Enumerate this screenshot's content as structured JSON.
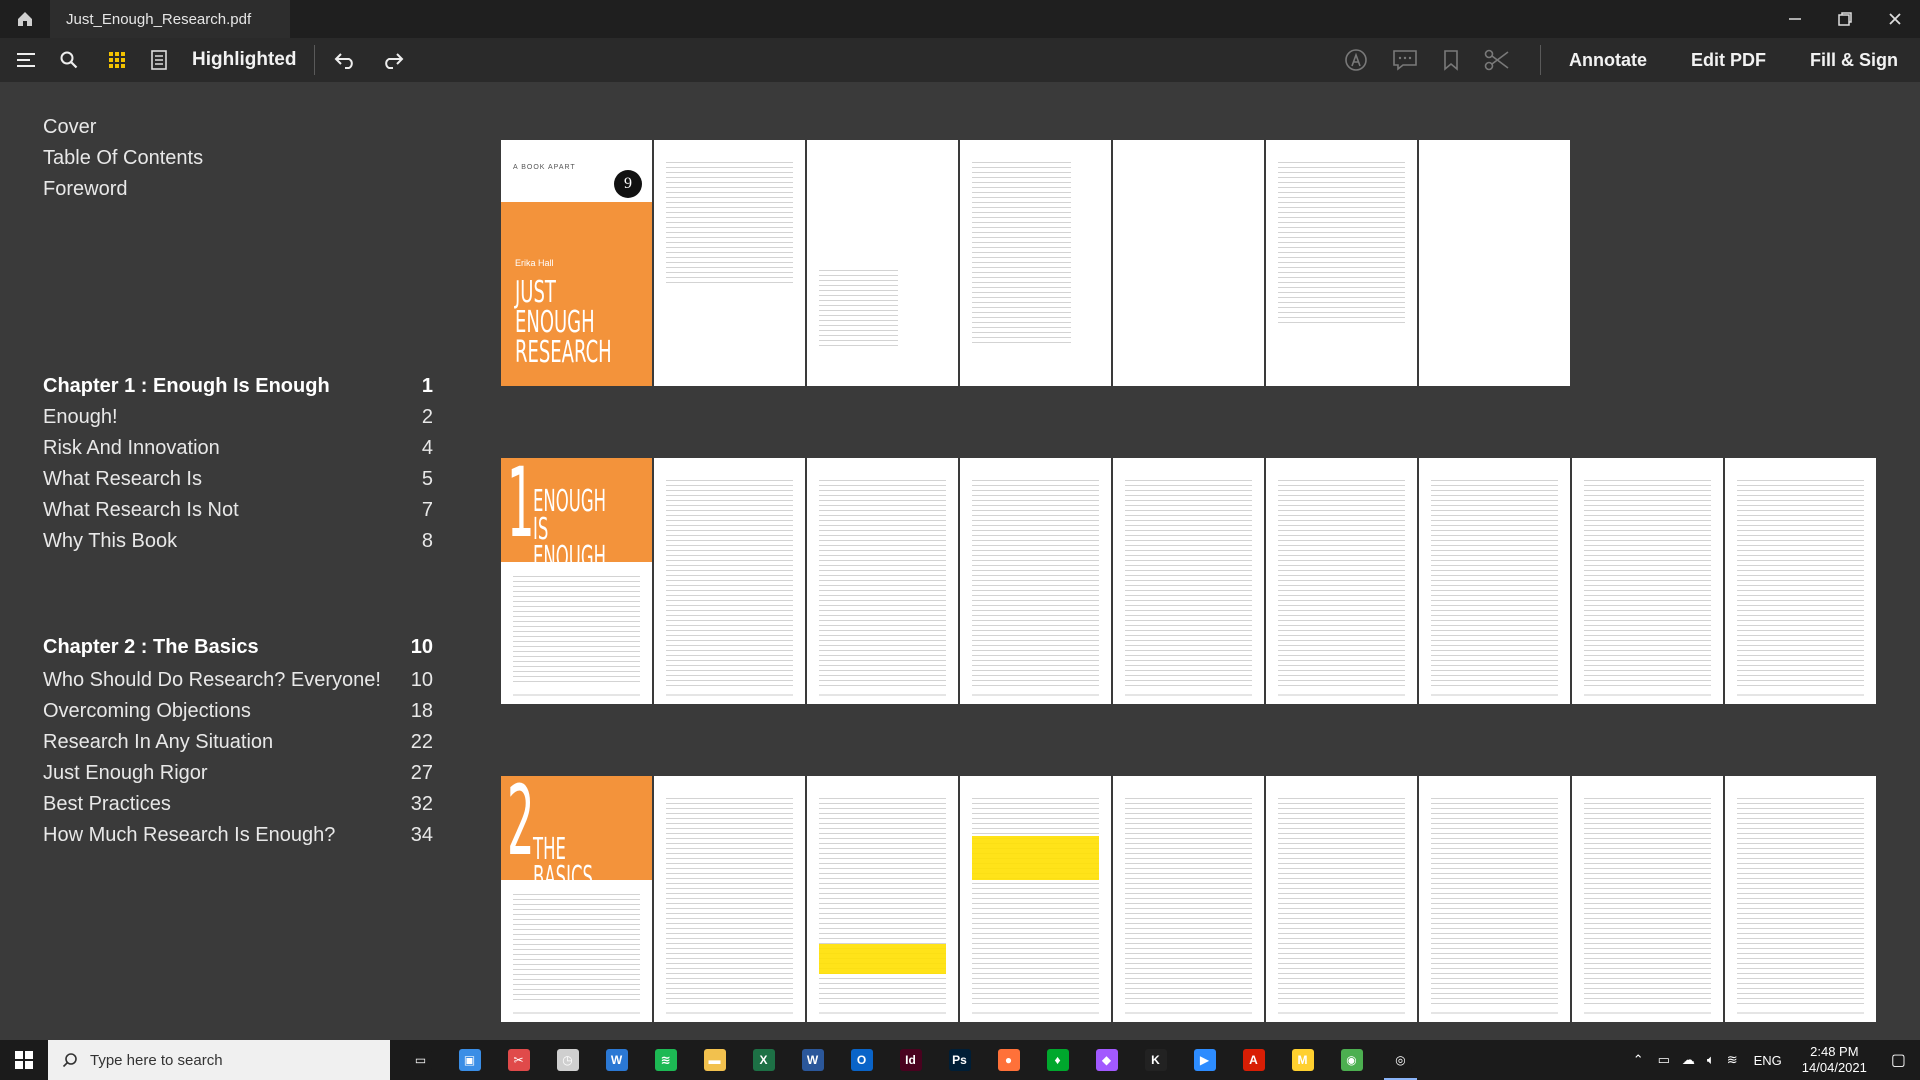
{
  "window": {
    "tab_title": "Just_Enough_Research.pdf"
  },
  "toolbar": {
    "view_label": "Highlighted",
    "annotate_label": "Annotate",
    "edit_label": "Edit PDF",
    "fill_sign_label": "Fill & Sign"
  },
  "toc": [
    {
      "label": "Cover",
      "page": "",
      "bold": false
    },
    {
      "label": "Table Of Contents",
      "page": "",
      "bold": false
    },
    {
      "label": "Foreword",
      "page": "",
      "bold": false
    },
    {
      "label": "Chapter 1 : Enough Is Enough",
      "page": "1",
      "bold": true
    },
    {
      "label": "Enough!",
      "page": "2",
      "bold": false
    },
    {
      "label": "Risk And Innovation",
      "page": "4",
      "bold": false
    },
    {
      "label": "What Research Is",
      "page": "5",
      "bold": false
    },
    {
      "label": "What Research Is Not",
      "page": "7",
      "bold": false
    },
    {
      "label": "Why This Book",
      "page": "8",
      "bold": false
    },
    {
      "label": "Chapter 2 : The Basics",
      "page": "10",
      "bold": true
    },
    {
      "label": "Who Should Do Research? Everyone!",
      "page": "10",
      "bold": false
    },
    {
      "label": "Overcoming Objections",
      "page": "18",
      "bold": false
    },
    {
      "label": "Research In Any Situation",
      "page": "22",
      "bold": false
    },
    {
      "label": "Just Enough Rigor",
      "page": "27",
      "bold": false
    },
    {
      "label": "Best Practices",
      "page": "32",
      "bold": false
    },
    {
      "label": "How Much Research Is Enough?",
      "page": "34",
      "bold": false
    }
  ],
  "cover": {
    "publisher": "A BOOK APART",
    "number": "9",
    "author": "Erika Hall",
    "title_line1": "JUST ENOUGH",
    "title_line2": "RESEARCH"
  },
  "chapters": [
    {
      "num": "1",
      "title_line1": "ENOUGH",
      "title_line2": "IS ENOUGH"
    },
    {
      "num": "2",
      "title_line1": "THE BASICS",
      "title_line2": ""
    }
  ],
  "taskbar": {
    "search_placeholder": "Type here to search",
    "time": "2:48 PM",
    "date": "14/04/2021",
    "lang": "ENG",
    "apps": [
      {
        "name": "task-view",
        "color": "#1b1b1b",
        "glyph": "▭"
      },
      {
        "name": "remote-desktop",
        "color": "#3a8ee6",
        "glyph": "▣"
      },
      {
        "name": "snip-tool",
        "color": "#e04a4a",
        "glyph": "✂"
      },
      {
        "name": "clock-app",
        "color": "#cfcfcf",
        "glyph": "◷"
      },
      {
        "name": "word-online",
        "color": "#2b78d4",
        "glyph": "W"
      },
      {
        "name": "spotify",
        "color": "#1db954",
        "glyph": "≋"
      },
      {
        "name": "file-explorer",
        "color": "#f2c14e",
        "glyph": "▬"
      },
      {
        "name": "excel",
        "color": "#1d7045",
        "glyph": "X"
      },
      {
        "name": "word",
        "color": "#2b579a",
        "glyph": "W"
      },
      {
        "name": "outlook",
        "color": "#0a64c8",
        "glyph": "O"
      },
      {
        "name": "indesign",
        "color": "#49021f",
        "glyph": "Id"
      },
      {
        "name": "photoshop",
        "color": "#001e36",
        "glyph": "Ps"
      },
      {
        "name": "firefox",
        "color": "#ff7139",
        "glyph": "●"
      },
      {
        "name": "evernote",
        "color": "#00a82d",
        "glyph": "♦"
      },
      {
        "name": "figma",
        "color": "#a259ff",
        "glyph": "◆"
      },
      {
        "name": "inkscape",
        "color": "#222222",
        "glyph": "K"
      },
      {
        "name": "zoom",
        "color": "#2d8cff",
        "glyph": "▶"
      },
      {
        "name": "acrobat",
        "color": "#d81e05",
        "glyph": "A"
      },
      {
        "name": "miro",
        "color": "#ffd02f",
        "glyph": "M"
      },
      {
        "name": "chrome",
        "color": "#4caf50",
        "glyph": "◉"
      },
      {
        "name": "pdf-reader",
        "color": "#1b1b1b",
        "glyph": "◎"
      }
    ]
  }
}
